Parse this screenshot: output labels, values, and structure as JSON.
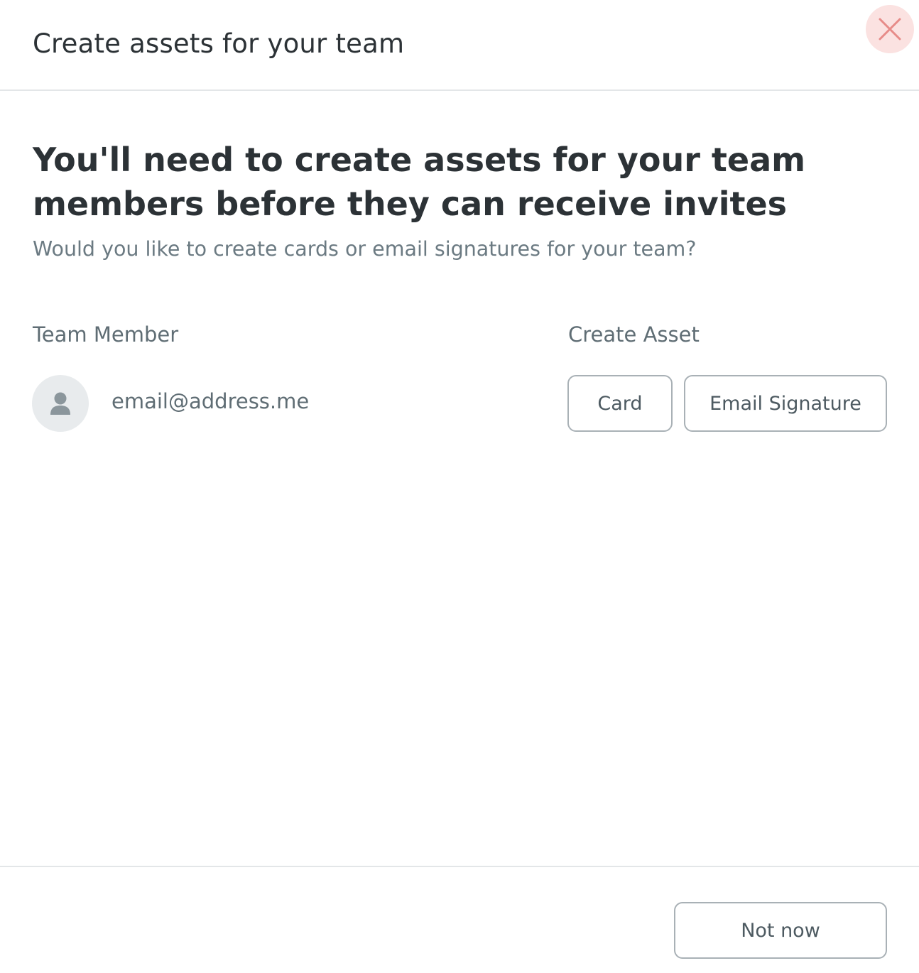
{
  "dialog": {
    "title": "Create assets for your team",
    "close_icon": "close-icon"
  },
  "content": {
    "headline": "You'll need to create assets for your team members before they can receive invites",
    "subtitle": "Would you like to create cards or email signatures for your team?"
  },
  "table": {
    "member_header": "Team Member",
    "asset_header": "Create Asset",
    "rows": [
      {
        "avatar_icon": "user-icon",
        "email": "email@address.me",
        "card_label": "Card",
        "signature_label": "Email Signature"
      }
    ]
  },
  "footer": {
    "not_now_label": "Not now"
  },
  "colors": {
    "close_bg": "#fbe2e1",
    "close_icon": "#e78b88",
    "text_dark": "#2c3236",
    "text_muted": "#5f6d74",
    "border": "#a9b1b6"
  }
}
